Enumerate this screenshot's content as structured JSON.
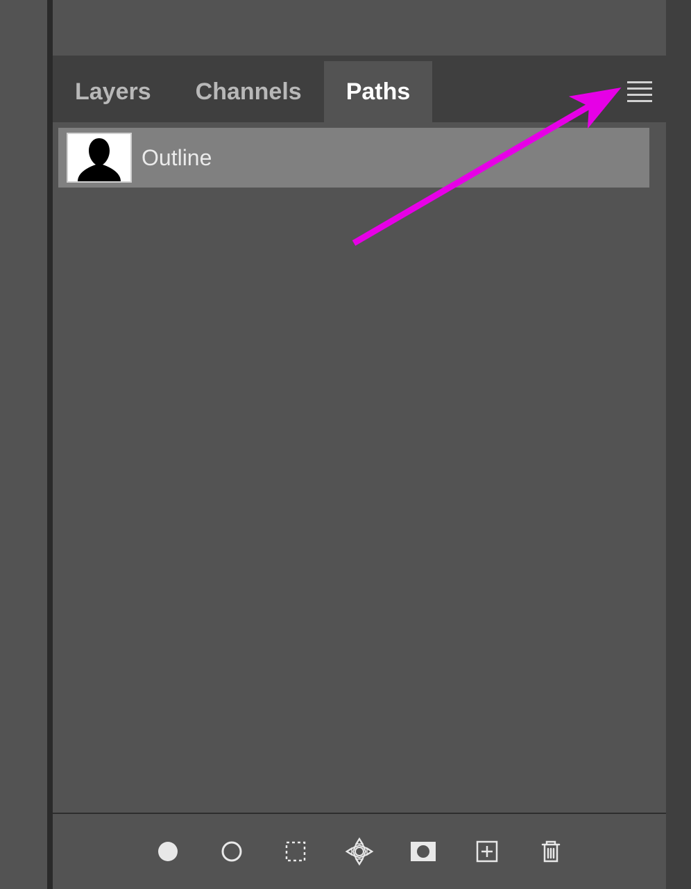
{
  "tabs": {
    "layers": "Layers",
    "channels": "Channels",
    "paths": "Paths"
  },
  "activeTab": "paths",
  "paths": {
    "items": [
      {
        "label": "Outline"
      }
    ]
  },
  "bottomTools": {
    "fill": "fill-path",
    "stroke": "stroke-path",
    "selection": "load-selection",
    "vectormask": "vector-mask",
    "mask": "add-mask",
    "newpath": "new-path",
    "delete": "delete-path"
  },
  "annotation": {
    "color": "#e600e6"
  }
}
